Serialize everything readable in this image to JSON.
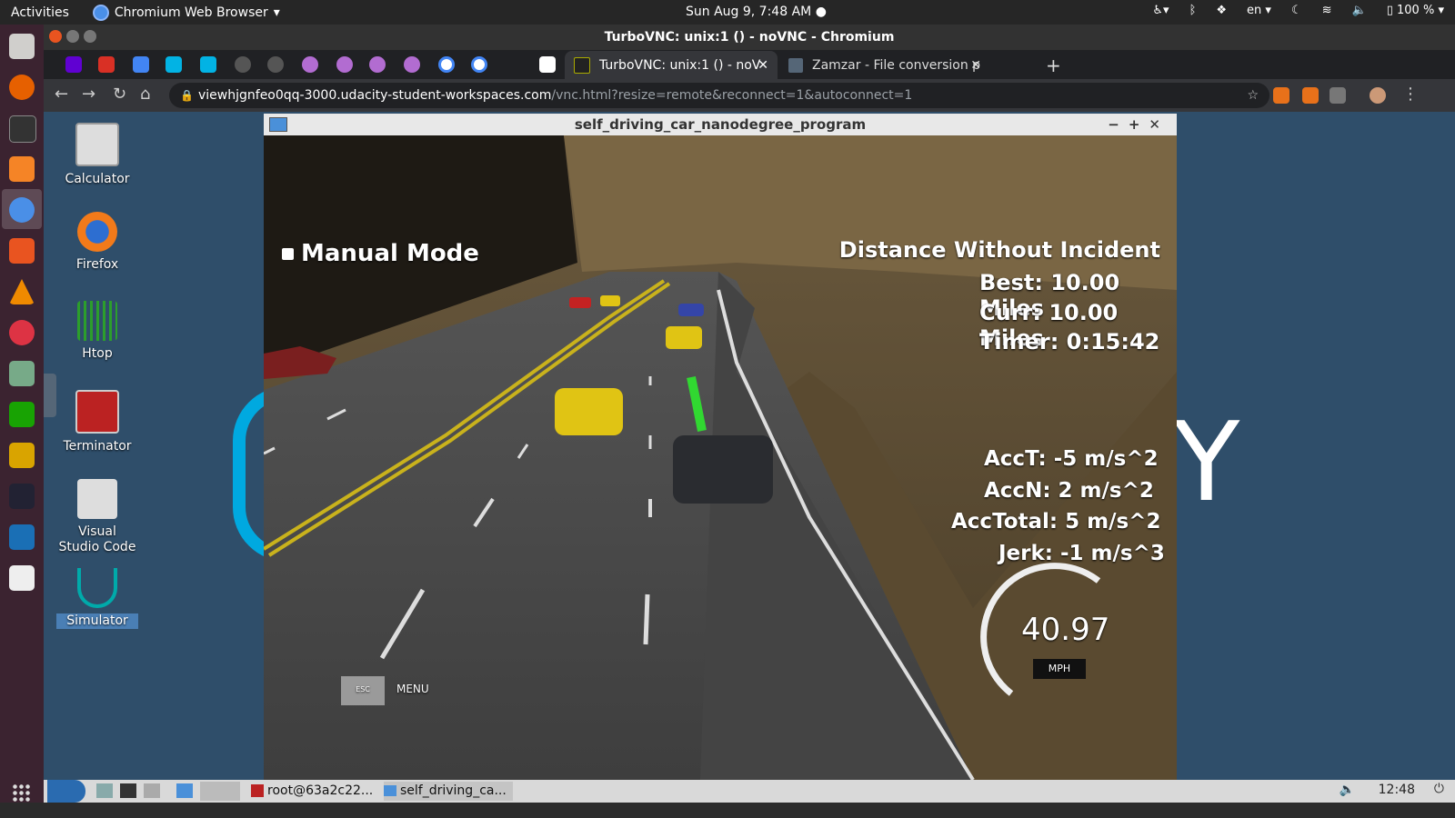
{
  "topbar": {
    "activities": "Activities",
    "app_name": "Chromium Web Browser",
    "clock": "Sun Aug  9,  7:48 AM",
    "lang": "en",
    "battery": "100 %"
  },
  "window": {
    "title": "TurboVNC: unix:1 () - noVNC - Chromium"
  },
  "tabs": [
    {
      "label": "TurboVNC: unix:1 () - noV",
      "active": true
    },
    {
      "label": "Zamzar - File conversion p",
      "active": false
    }
  ],
  "address": {
    "host": "viewhjgnfeo0qq-3000.udacity-student-workspaces.com",
    "path": "/vnc.html?resize=remote&reconnect=1&autoconnect=1"
  },
  "desktop_icons": [
    {
      "label": "Calculator",
      "icon": "calculator-icon"
    },
    {
      "label": "Firefox",
      "icon": "firefox-icon"
    },
    {
      "label": "Htop",
      "icon": "htop-icon"
    },
    {
      "label": "Terminator",
      "icon": "terminator-icon"
    },
    {
      "label": "Visual Studio Code",
      "icon": "vscode-icon"
    },
    {
      "label": "Simulator",
      "icon": "udacity-icon"
    }
  ],
  "vnc_window": {
    "title": "self_driving_car_nanodegree_program"
  },
  "simulator": {
    "mode": "Manual Mode",
    "distance_header": "Distance Without Incident",
    "best": "Best: 10.00 Miles",
    "curr": "Curr: 10.00 Miles",
    "timer": "Timer: 0:15:42",
    "acct": "AccT: -5 m/s^2",
    "accn": "AccN: 2 m/s^2",
    "acctotal": "AccTotal: 5 m/s^2",
    "jerk": "Jerk: -1 m/s^3",
    "speed": "40.97",
    "speed_unit": "MPH",
    "esc_key": "ESC",
    "menu": "MENU"
  },
  "taskbar": {
    "terminal": "root@63a2c22...",
    "window": "self_driving_ca...",
    "clock": "12:48"
  }
}
